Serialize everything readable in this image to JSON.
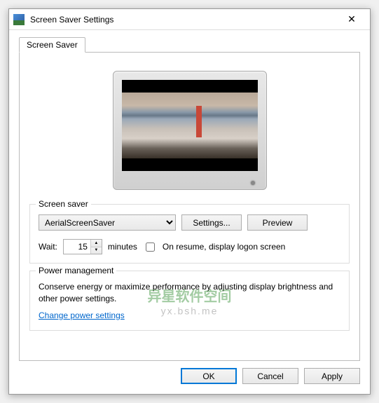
{
  "titlebar": {
    "title": "Screen Saver Settings",
    "close_glyph": "✕"
  },
  "tabs": {
    "main": "Screen Saver"
  },
  "screensaver_group": {
    "label": "Screen saver",
    "selected": "AerialScreenSaver",
    "settings_btn": "Settings...",
    "preview_btn": "Preview",
    "wait_label": "Wait:",
    "wait_value": "15",
    "minutes_label": "minutes",
    "resume_label": "On resume, display logon screen"
  },
  "power_group": {
    "label": "Power management",
    "desc": "Conserve energy or maximize performance by adjusting display brightness and other power settings.",
    "link": "Change power settings"
  },
  "footer": {
    "ok": "OK",
    "cancel": "Cancel",
    "apply": "Apply"
  },
  "watermark": {
    "line1": "异星软件空间",
    "line2": "yx.bsh.me"
  }
}
